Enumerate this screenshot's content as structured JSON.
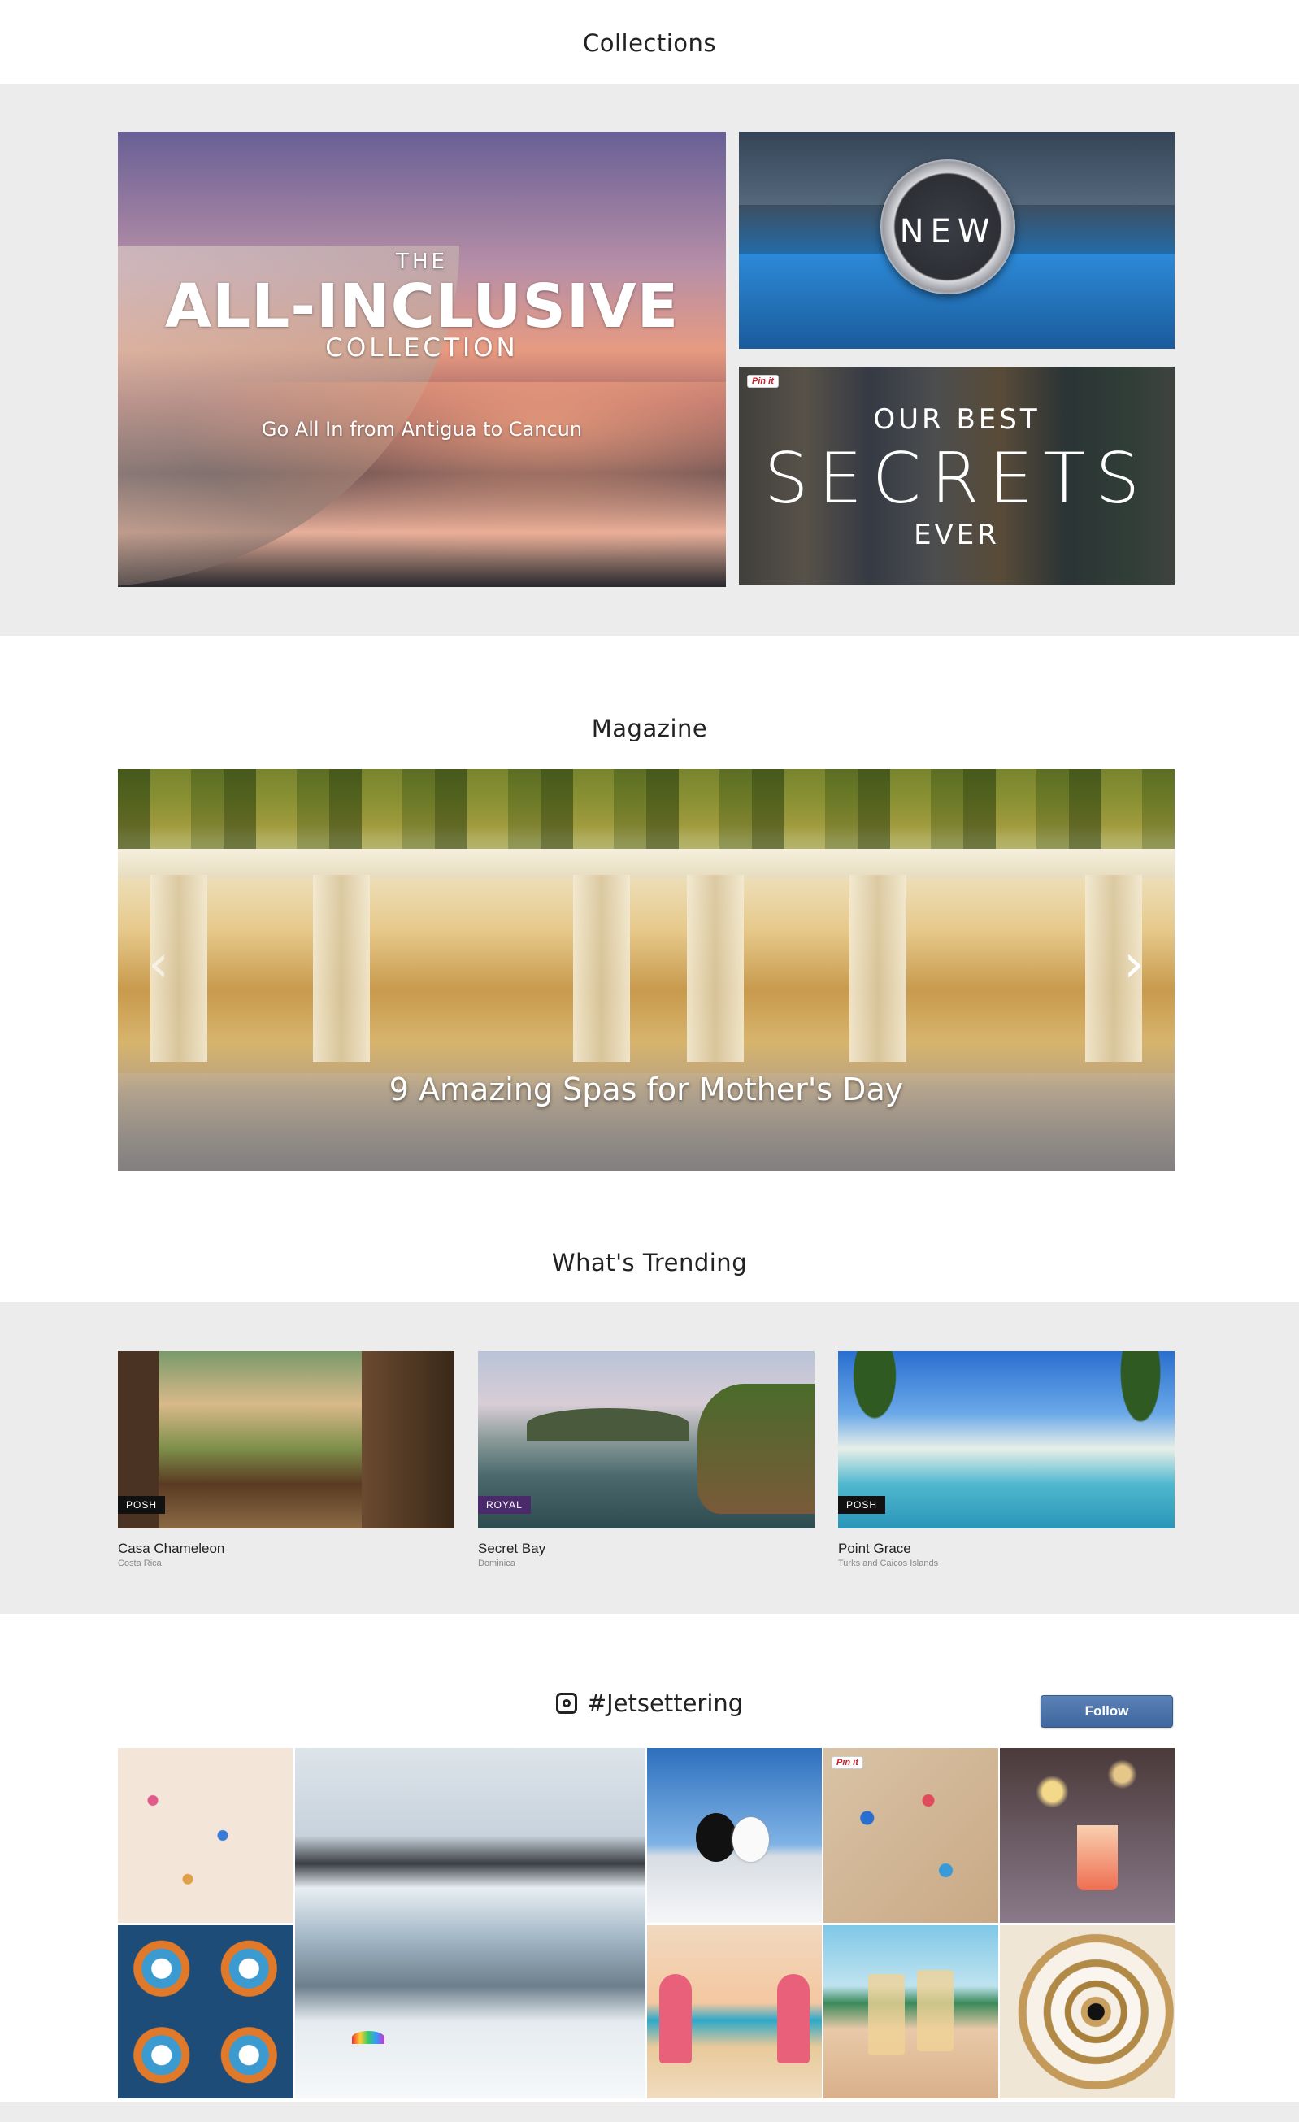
{
  "collections": {
    "title": "Collections",
    "hero": {
      "pre": "THE",
      "headline": "ALL-INCLUSIVE",
      "sub": "COLLECTION",
      "tagline": "Go All In from Antigua to Cancun"
    },
    "new_tile": {
      "label": "NEW"
    },
    "secrets_tile": {
      "line1": "OUR BEST",
      "line2": "SECRETS",
      "line3": "EVER",
      "pin_label": "Pin it"
    }
  },
  "magazine": {
    "title": "Magazine",
    "caption": "9 Amazing Spas for Mother's Day",
    "prev_glyph": "‹",
    "next_glyph": "›"
  },
  "trending": {
    "title": "What's Trending",
    "cards": [
      {
        "name": "Casa Chameleon",
        "location": "Costa Rica",
        "badge": "POSH",
        "badge_color": "#111111"
      },
      {
        "name": "Secret Bay",
        "location": "Dominica",
        "badge": "ROYAL",
        "badge_color": "#4b2a6b"
      },
      {
        "name": "Point Grace",
        "location": "Turks and Caicos Islands",
        "badge": "POSH",
        "badge_color": "#111111"
      }
    ]
  },
  "instagram": {
    "title": "#Jetsettering",
    "icon": "instagram-icon",
    "follow_label": "Follow",
    "pin_label": "Pin it"
  },
  "colors": {
    "band_gray": "#ececec",
    "follow_blue": "#4a72a8",
    "royal_purple": "#4b2a6b"
  }
}
